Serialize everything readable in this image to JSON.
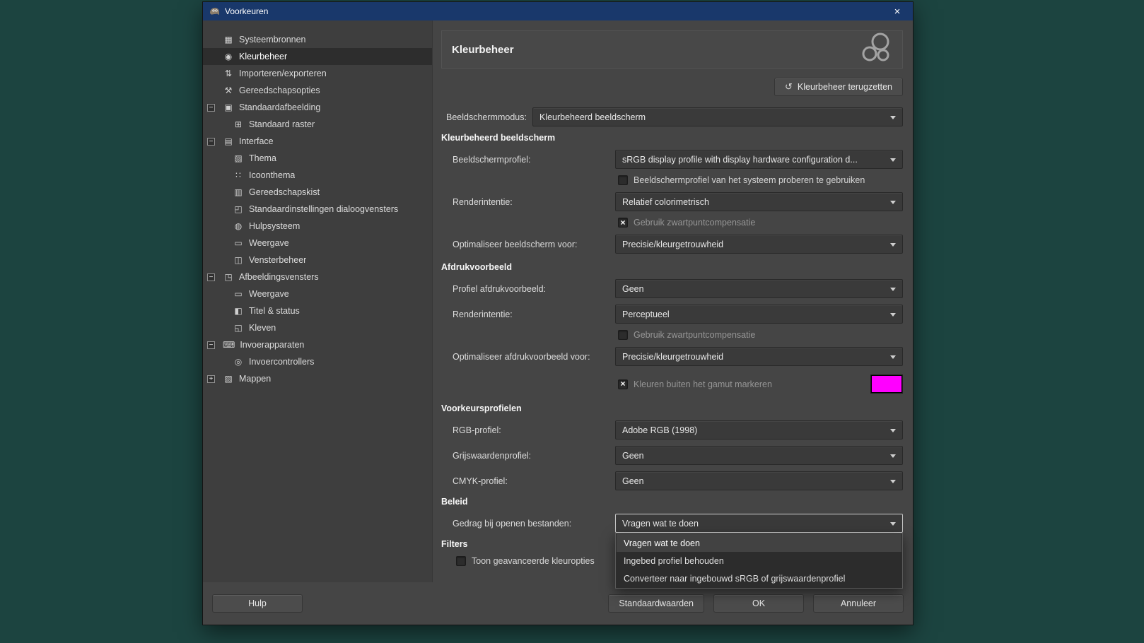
{
  "window": {
    "title": "Voorkeuren"
  },
  "icons": {
    "close": "×",
    "reset": "↺",
    "check": "×"
  },
  "colors": {
    "titlebar": "#19386b",
    "dialog_background": "#454545",
    "gamut_swatch": "#ff00ff",
    "selection": "#2d2d2d"
  },
  "sidebar": {
    "items": [
      {
        "label": "Systeembronnen",
        "icon": "▦",
        "expander": ""
      },
      {
        "label": "Kleurbeheer",
        "icon": "◉",
        "expander": ""
      },
      {
        "label": "Importeren/exporteren",
        "icon": "⇅",
        "expander": ""
      },
      {
        "label": "Gereedschapsopties",
        "icon": "⚒",
        "expander": ""
      },
      {
        "label": "Standaardafbeelding",
        "icon": "▣",
        "expander": "−"
      },
      {
        "label": "Standaard raster",
        "icon": "⊞",
        "expander": ""
      },
      {
        "label": "Interface",
        "icon": "▤",
        "expander": "−"
      },
      {
        "label": "Thema",
        "icon": "▨",
        "expander": ""
      },
      {
        "label": "Icoonthema",
        "icon": "∷",
        "expander": ""
      },
      {
        "label": "Gereedschapskist",
        "icon": "▥",
        "expander": ""
      },
      {
        "label": "Standaardinstellingen dialoogvensters",
        "icon": "◰",
        "expander": ""
      },
      {
        "label": "Hulpsysteem",
        "icon": "◍",
        "expander": ""
      },
      {
        "label": "Weergave",
        "icon": "▭",
        "expander": ""
      },
      {
        "label": "Vensterbeheer",
        "icon": "◫",
        "expander": ""
      },
      {
        "label": "Afbeeldingsvensters",
        "icon": "◳",
        "expander": "−"
      },
      {
        "label": "Weergave",
        "icon": "▭",
        "expander": ""
      },
      {
        "label": "Titel & status",
        "icon": "◧",
        "expander": ""
      },
      {
        "label": "Kleven",
        "icon": "◱",
        "expander": ""
      },
      {
        "label": "Invoerapparaten",
        "icon": "⌨",
        "expander": "−"
      },
      {
        "label": "Invoercontrollers",
        "icon": "◎",
        "expander": ""
      },
      {
        "label": "Mappen",
        "icon": "▧",
        "expander": "+"
      }
    ]
  },
  "panel": {
    "title": "Kleurbeheer",
    "reset_button": "Kleurbeheer terugzetten"
  },
  "form": {
    "display_mode": {
      "label": "Beeldschermmodus:",
      "value": "Kleurbeheerd beeldscherm"
    },
    "managed": {
      "title": "Kleurbeheerd beeldscherm",
      "profile": {
        "label": "Beeldschermprofiel:",
        "value": "sRGB display profile with display hardware configuration d..."
      },
      "try_system": {
        "label": "Beeldschermprofiel van het systeem proberen te gebruiken",
        "checked": false
      },
      "intent": {
        "label": "Renderintentie:",
        "value": "Relatief colorimetrisch"
      },
      "bpc": {
        "label": "Gebruik zwartpuntcompensatie",
        "checked": true
      },
      "optimize": {
        "label": "Optimaliseer beeldscherm voor:",
        "value": "Precisie/kleurgetrouwheid"
      }
    },
    "softproof": {
      "title": "Afdrukvoorbeeld",
      "profile": {
        "label": "Profiel afdrukvoorbeeld:",
        "value": "Geen"
      },
      "intent": {
        "label": "Renderintentie:",
        "value": "Perceptueel"
      },
      "bpc": {
        "label": "Gebruik zwartpuntcompensatie",
        "checked": false
      },
      "optimize": {
        "label": "Optimaliseer afdrukvoorbeeld voor:",
        "value": "Precisie/kleurgetrouwheid"
      },
      "gamut": {
        "label": "Kleuren buiten het gamut markeren",
        "checked": true,
        "swatch_color": "#ff00ff"
      }
    },
    "profiles": {
      "title": "Voorkeursprofielen",
      "rgb": {
        "label": "RGB-profiel:",
        "value": "Adobe RGB (1998)"
      },
      "gray": {
        "label": "Grijswaardenprofiel:",
        "value": "Geen"
      },
      "cmyk": {
        "label": "CMYK-profiel:",
        "value": "Geen"
      }
    },
    "policy": {
      "title": "Beleid",
      "behavior": {
        "label": "Gedrag bij openen bestanden:",
        "value": "Vragen wat te doen"
      },
      "dropdown_open": true,
      "options": [
        "Vragen wat te doen",
        "Ingebed profiel behouden",
        "Converteer naar ingebouwd sRGB of grijswaardenprofiel"
      ],
      "selected_option_index": 0
    },
    "filters": {
      "title": "Filters",
      "advanced": {
        "label": "Toon geavanceerde kleuropties",
        "checked": false
      }
    }
  },
  "footer": {
    "help": "Hulp",
    "defaults": "Standaardwaarden",
    "ok": "OK",
    "cancel": "Annuleer"
  }
}
